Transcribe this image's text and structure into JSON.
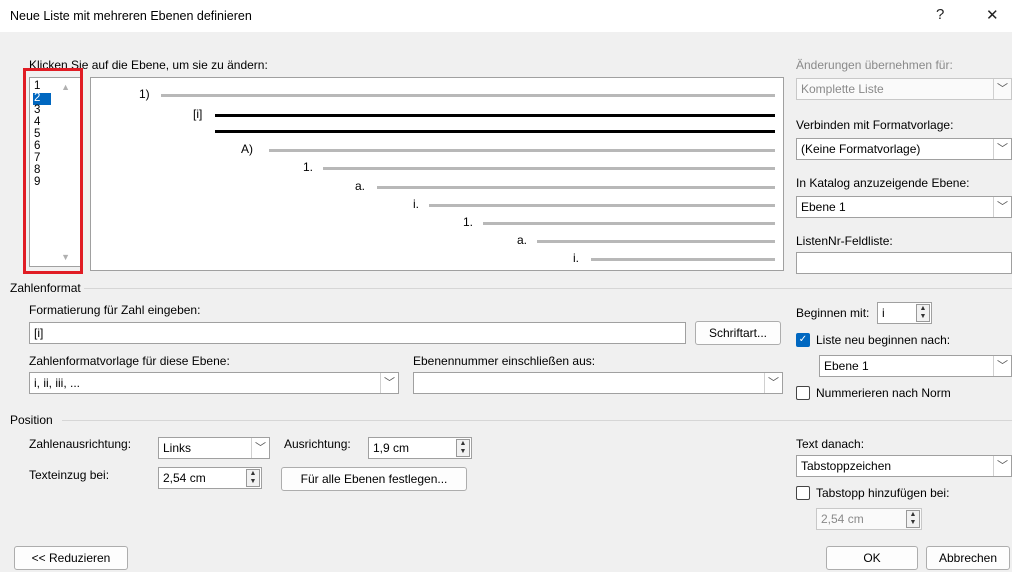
{
  "dialog": {
    "title": "Neue Liste mit mehreren Ebenen definieren",
    "help": "?",
    "close": "✕"
  },
  "levels": {
    "label": "Klicken Sie auf die Ebene, um sie zu ändern:",
    "items": [
      "1",
      "2",
      "3",
      "4",
      "5",
      "6",
      "7",
      "8",
      "9"
    ],
    "selected": "2"
  },
  "preview": {
    "numbers": [
      "1)",
      "[i]",
      "A)",
      "1.",
      "a.",
      "i.",
      "1.",
      "a.",
      "i."
    ]
  },
  "right_panel": {
    "apply_label": "Änderungen übernehmen für:",
    "apply_value": "Komplette Liste",
    "link_style_label": "Verbinden mit Formatvorlage:",
    "link_style_value": "(Keine Formatvorlage)",
    "gallery_level_label": "In Katalog anzuzeigende Ebene:",
    "gallery_level_value": "Ebene 1",
    "listnum_label": "ListenNr-Feldliste:",
    "listnum_value": ""
  },
  "number_format": {
    "group_label": "Zahlenformat",
    "enter_format_label": "Formatierung für Zahl eingeben:",
    "format_value": "[i]",
    "font_button": "Schriftart...",
    "style_label": "Zahlenformatvorlage für diese Ebene:",
    "style_value": "i, ii, iii, ...",
    "include_label": "Ebenennummer einschließen aus:",
    "include_value": "",
    "start_at_label": "Beginnen mit:",
    "start_at_value": "i",
    "restart_label": "Liste neu beginnen nach:",
    "restart_checked": true,
    "restart_value": "Ebene 1",
    "legal_label": "Nummerieren nach Norm",
    "legal_checked": false
  },
  "position": {
    "group_label": "Position",
    "alignment_label": "Zahlenausrichtung:",
    "alignment_value": "Links",
    "aligned_at_label": "Ausrichtung:",
    "aligned_at_value": "1,9 cm",
    "indent_label": "Texteinzug bei:",
    "indent_value": "2,54 cm",
    "set_all_button": "Für alle Ebenen festlegen...",
    "follow_label": "Text danach:",
    "follow_value": "Tabstoppzeichen",
    "add_tab_label": "Tabstopp hinzufügen bei:",
    "add_tab_checked": false,
    "add_tab_value": "2,54 cm"
  },
  "footer": {
    "less_button": "<< Reduzieren",
    "ok_button": "OK",
    "cancel_button": "Abbrechen"
  },
  "colors": {
    "accent": "#0067c0",
    "highlight_box": "#e01c24"
  }
}
